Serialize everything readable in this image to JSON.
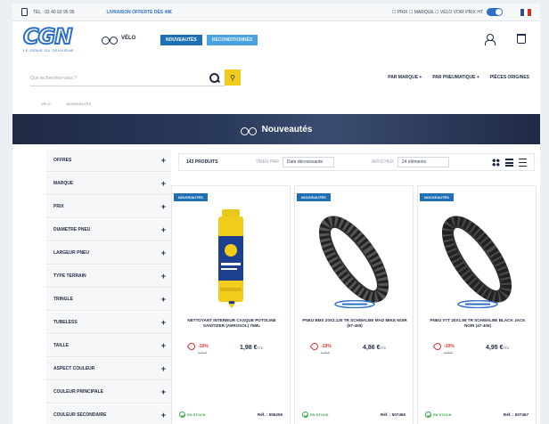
{
  "topbar": {
    "phone": "TÉL : 02 40 92 95 95",
    "promo": "LIVRAISON OFFERTE DÈS 49€",
    "options": "☐ PRIX ☐ MARQUE ☐ VÉLO   VOIR PRIX HT",
    "flag": "FR"
  },
  "header": {
    "logo_text": "CGN",
    "logo_tagline": "LE GÉNIE DU DEUXIÈME",
    "category": "VÉLO",
    "btn_nouveautes": "NOUVEAUTÉS",
    "btn_reconditionnes": "RECONDITIONNÉS"
  },
  "search": {
    "placeholder": "Que recherchez-vous ?"
  },
  "nav": {
    "marque": "PAR MARQUE +",
    "pneumatique": "PAR PNEUMATIQUE +",
    "origine": "PIÈCES ORIGINES"
  },
  "breadcrumb": {
    "home": "VÉLO",
    "current": "NOUVEAUTÉS"
  },
  "banner": {
    "title": "Nouveautés"
  },
  "filters": [
    "OFFRES",
    "MARQUE",
    "PRIX",
    "DIAMETRE PNEU",
    "LARGEUR PNEU",
    "TYPE TERRAIN",
    "TRINGLE",
    "TUBELESS",
    "TAILLE",
    "ASPECT COULEUR",
    "COULEUR PRINCIPALE",
    "COULEUR SECONDAIRE"
  ],
  "toolbar": {
    "count": "143 PRODUITS",
    "sort_label": "TRIER PAR",
    "sort_value": "Date décroissante",
    "per_page_label": "AFFICHER",
    "per_page_value": "24 éléments"
  },
  "products": [
    {
      "badge": "NOUVEAUTÉS",
      "name": "NETTOYANT INTERIEUR CASQUE POTOLINE SANITIZER (AEROSOL) 75ML",
      "discount": "-10%",
      "old_price": "2,20 €",
      "price": "1,98 €",
      "price_unit": "TTC",
      "stock": "EN STOCK",
      "ref": "Réf. : 506206"
    },
    {
      "badge": "NOUVEAUTÉS",
      "name": "PNEU BMX 20X2.125 TR SCHWALBE MAD MIKE NOIR (57-406)",
      "discount": "-10%",
      "old_price": "5,40 €",
      "price": "4,86 €",
      "price_unit": "TTC",
      "stock": "EN STOCK",
      "ref": "Réf. : 507466"
    },
    {
      "badge": "NOUVEAUTÉS",
      "name": "PNEU VTT 20X1.95 TR SCHWALBE BLACK JACK NOIR (47-406)",
      "discount": "-10%",
      "old_price": "5,50 €",
      "price": "4,95 €",
      "price_unit": "TTC",
      "stock": "EN STOCK",
      "ref": "Réf. : 507467"
    }
  ],
  "colors": {
    "brand_blue": "#2d6fc4",
    "navy": "#1f2a44",
    "accent_yellow": "#f2cc1a",
    "discount_red": "#d0312d",
    "stock_green": "#3aa64a"
  }
}
